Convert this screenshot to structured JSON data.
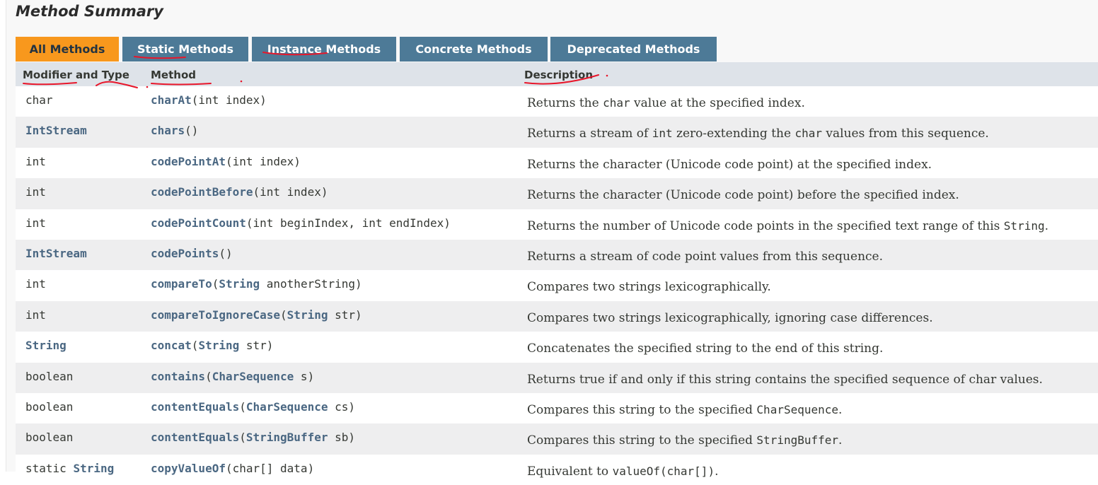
{
  "section": {
    "title": "Method Summary"
  },
  "tabs": [
    {
      "label": "All Methods",
      "active": true
    },
    {
      "label": "Static Methods",
      "active": false
    },
    {
      "label": "Instance Methods",
      "active": false
    },
    {
      "label": "Concrete Methods",
      "active": false
    },
    {
      "label": "Deprecated Methods",
      "active": false
    }
  ],
  "columns": {
    "modifier": "Modifier and Type",
    "method": "Method",
    "description": "Description"
  },
  "rows": [
    {
      "type": [
        {
          "t": "char",
          "link": false
        }
      ],
      "method": [
        {
          "t": "charAt",
          "link": true
        },
        {
          "t": "(int index)",
          "link": false
        }
      ],
      "desc": [
        {
          "t": "Returns the "
        },
        {
          "t": "char",
          "code": true
        },
        {
          "t": " value at the specified index."
        }
      ]
    },
    {
      "type": [
        {
          "t": "IntStream",
          "link": true
        }
      ],
      "method": [
        {
          "t": "chars",
          "link": true
        },
        {
          "t": "()",
          "link": false
        }
      ],
      "desc": [
        {
          "t": "Returns a stream of "
        },
        {
          "t": "int",
          "code": true
        },
        {
          "t": " zero-extending the "
        },
        {
          "t": "char",
          "code": true
        },
        {
          "t": " values from this sequence."
        }
      ]
    },
    {
      "type": [
        {
          "t": "int",
          "link": false
        }
      ],
      "method": [
        {
          "t": "codePointAt",
          "link": true
        },
        {
          "t": "(int index)",
          "link": false
        }
      ],
      "desc": [
        {
          "t": "Returns the character (Unicode code point) at the specified index."
        }
      ]
    },
    {
      "type": [
        {
          "t": "int",
          "link": false
        }
      ],
      "method": [
        {
          "t": "codePointBefore",
          "link": true
        },
        {
          "t": "(int index)",
          "link": false
        }
      ],
      "desc": [
        {
          "t": "Returns the character (Unicode code point) before the specified index."
        }
      ]
    },
    {
      "type": [
        {
          "t": "int",
          "link": false
        }
      ],
      "method": [
        {
          "t": "codePointCount",
          "link": true
        },
        {
          "t": "(int beginIndex, int endIndex)",
          "link": false
        }
      ],
      "desc": [
        {
          "t": "Returns the number of Unicode code points in the specified text range of this "
        },
        {
          "t": "String",
          "code": true
        },
        {
          "t": "."
        }
      ]
    },
    {
      "type": [
        {
          "t": "IntStream",
          "link": true
        }
      ],
      "method": [
        {
          "t": "codePoints",
          "link": true
        },
        {
          "t": "()",
          "link": false
        }
      ],
      "desc": [
        {
          "t": "Returns a stream of code point values from this sequence."
        }
      ]
    },
    {
      "type": [
        {
          "t": "int",
          "link": false
        }
      ],
      "method": [
        {
          "t": "compareTo",
          "link": true
        },
        {
          "t": "(",
          "link": false
        },
        {
          "t": "String",
          "link": true
        },
        {
          "t": " anotherString)",
          "link": false
        }
      ],
      "desc": [
        {
          "t": "Compares two strings lexicographically."
        }
      ]
    },
    {
      "type": [
        {
          "t": "int",
          "link": false
        }
      ],
      "method": [
        {
          "t": "compareToIgnoreCase",
          "link": true
        },
        {
          "t": "(",
          "link": false
        },
        {
          "t": "String",
          "link": true
        },
        {
          "t": " str)",
          "link": false
        }
      ],
      "desc": [
        {
          "t": "Compares two strings lexicographically, ignoring case differences."
        }
      ]
    },
    {
      "type": [
        {
          "t": "String",
          "link": true
        }
      ],
      "method": [
        {
          "t": "concat",
          "link": true
        },
        {
          "t": "(",
          "link": false
        },
        {
          "t": "String",
          "link": true
        },
        {
          "t": " str)",
          "link": false
        }
      ],
      "desc": [
        {
          "t": "Concatenates the specified string to the end of this string."
        }
      ]
    },
    {
      "type": [
        {
          "t": "boolean",
          "link": false
        }
      ],
      "method": [
        {
          "t": "contains",
          "link": true
        },
        {
          "t": "(",
          "link": false
        },
        {
          "t": "CharSequence",
          "link": true
        },
        {
          "t": " s)",
          "link": false
        }
      ],
      "desc": [
        {
          "t": "Returns true if and only if this string contains the specified sequence of char values."
        }
      ]
    },
    {
      "type": [
        {
          "t": "boolean",
          "link": false
        }
      ],
      "method": [
        {
          "t": "contentEquals",
          "link": true
        },
        {
          "t": "(",
          "link": false
        },
        {
          "t": "CharSequence",
          "link": true
        },
        {
          "t": " cs)",
          "link": false
        }
      ],
      "desc": [
        {
          "t": "Compares this string to the specified "
        },
        {
          "t": "CharSequence",
          "code": true
        },
        {
          "t": "."
        }
      ]
    },
    {
      "type": [
        {
          "t": "boolean",
          "link": false
        }
      ],
      "method": [
        {
          "t": "contentEquals",
          "link": true
        },
        {
          "t": "(",
          "link": false
        },
        {
          "t": "StringBuffer",
          "link": true
        },
        {
          "t": " sb)",
          "link": false
        }
      ],
      "desc": [
        {
          "t": "Compares this string to the specified "
        },
        {
          "t": "StringBuffer",
          "code": true
        },
        {
          "t": "."
        }
      ]
    },
    {
      "type": [
        {
          "t": "static ",
          "link": false
        },
        {
          "t": "String",
          "link": true
        }
      ],
      "method": [
        {
          "t": "copyValueOf",
          "link": true
        },
        {
          "t": "(char[] data)",
          "link": false
        }
      ],
      "desc": [
        {
          "t": "Equivalent to "
        },
        {
          "t": "valueOf(char[])",
          "code": true
        },
        {
          "t": "."
        }
      ]
    }
  ],
  "colors": {
    "tab_active": "#f8981d",
    "tab_inactive": "#4d7a97",
    "header_bg": "#dee3e9",
    "link": "#4a6782",
    "row_alt": "#eeeeef",
    "annotation": "#e8162a"
  }
}
